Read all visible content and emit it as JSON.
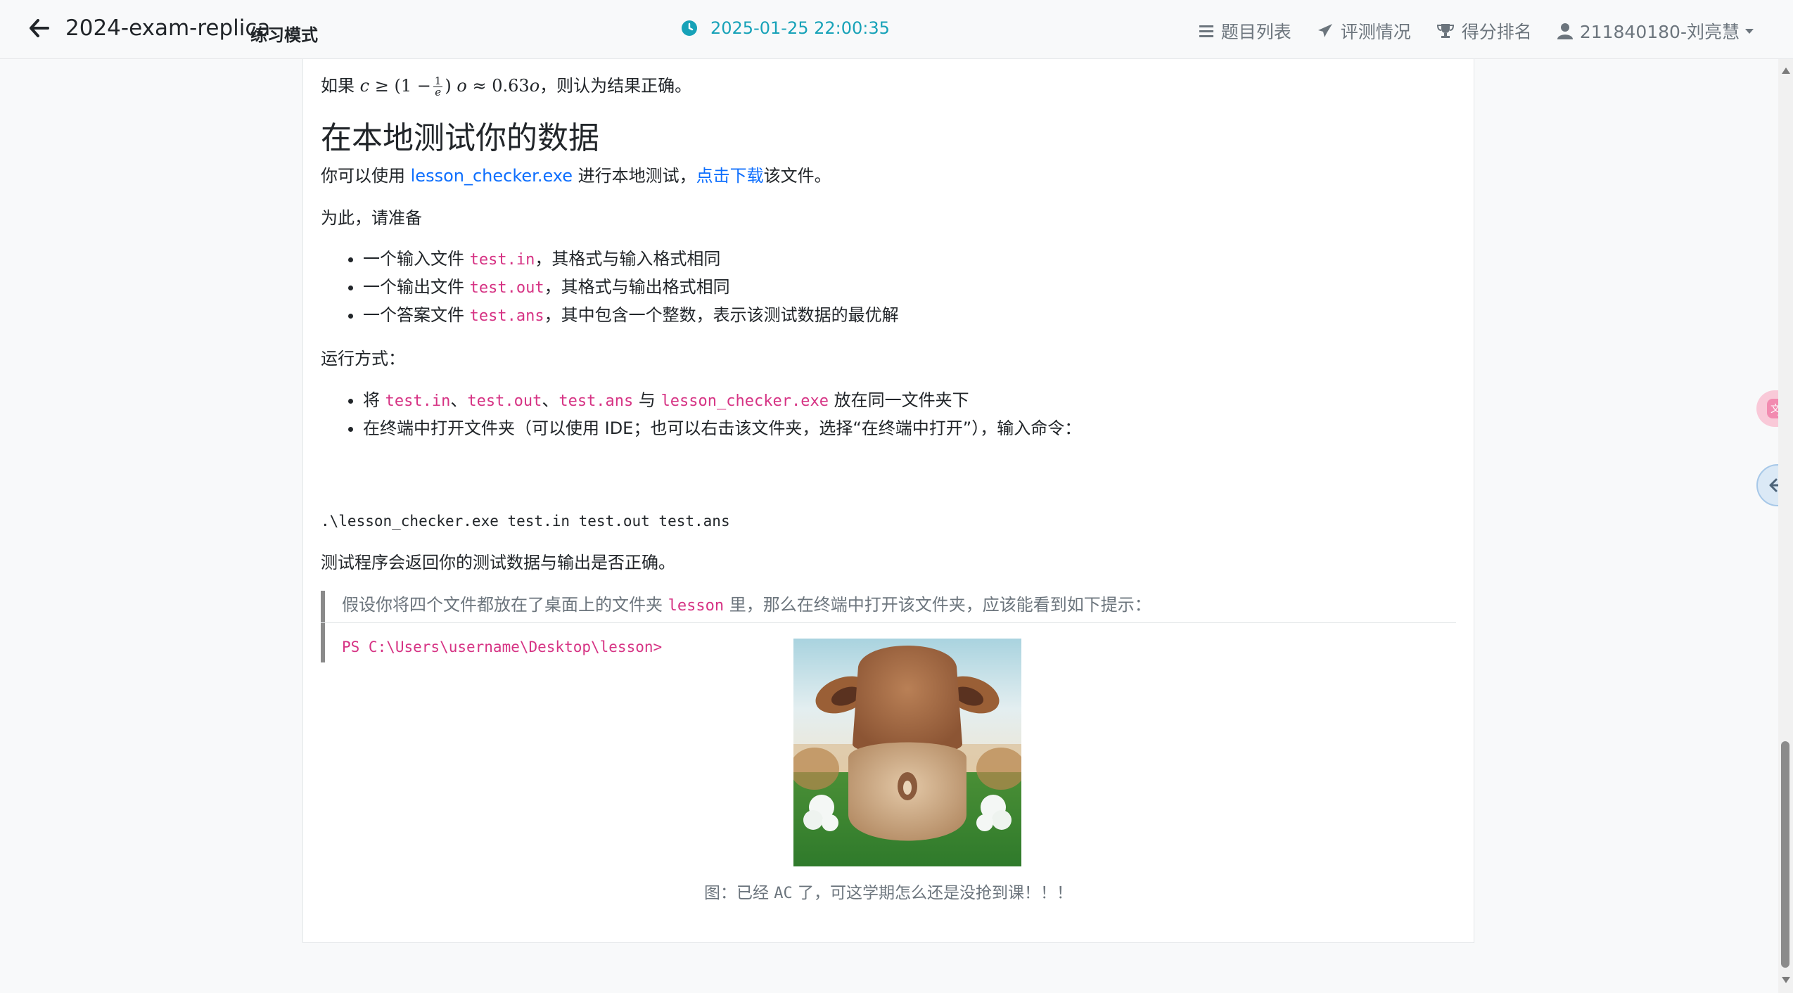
{
  "navbar": {
    "title": "2024-exam-replica",
    "mode": "练习模式",
    "time": "2025-01-25 22:00:35",
    "items": [
      {
        "label": "题目列表",
        "icon": "list-icon"
      },
      {
        "label": "评测情况",
        "icon": "paper-plane-icon"
      },
      {
        "label": "得分排名",
        "icon": "trophy-icon"
      },
      {
        "label": "211840180-刘亮慧",
        "icon": "user-icon"
      }
    ]
  },
  "content": {
    "condition": {
      "prefix": "如果",
      "suffix": "，则认为结果正确。",
      "formula": {
        "var_c": "c",
        "geq": "≥",
        "open": "(1 −",
        "frac_num": "1",
        "frac_den": "e",
        "close": ")",
        "var_o": "o",
        "approx": "≈ 0.63",
        "var_o2": "o"
      }
    },
    "heading": "在本地测试你的数据",
    "intro": {
      "prefix": "你可以使用 ",
      "link1": "lesson_checker.exe",
      "middle": " 进行本地测试，",
      "link2": "点击下载",
      "suffix": "该文件。"
    },
    "prepare": "为此，请准备",
    "prep_items": [
      {
        "before": "一个输入文件 ",
        "code": "test.in",
        "after": "，其格式与输入格式相同"
      },
      {
        "before": "一个输出文件 ",
        "code": "test.out",
        "after": "，其格式与输出格式相同"
      },
      {
        "before": "一个答案文件 ",
        "code": "test.ans",
        "after": "，其中包含一个整数，表示该测试数据的最优解"
      }
    ],
    "run_label": "运行方式：",
    "run_item1": {
      "t1": "将 ",
      "c1": "test.in",
      "t2": "、",
      "c2": "test.out",
      "t3": "、",
      "c3": "test.ans",
      "t4": " 与 ",
      "c4": "lesson_checker.exe",
      "t5": " 放在同一文件夹下"
    },
    "run_item2": "在终端中打开文件夹（可以使用 IDE；也可以右击该文件夹，选择“在终端中打开”），输入命令：",
    "command": ".\\lesson_checker.exe test.in test.out test.ans",
    "result_text": "测试程序会返回你的测试数据与输出是否正确。",
    "quote": {
      "before": "假设你将四个文件都放在了桌面上的文件夹 ",
      "code": "lesson",
      "after": " 里，那么在终端中打开该文件夹，应该能看到如下提示：",
      "prompt": "PS C:\\Users\\username\\Desktop\\lesson>"
    },
    "caption": {
      "before": "图：已经 ",
      "code": "AC",
      "after": " 了，可这学期怎么还是没抢到课！！！"
    }
  },
  "side_buttons": {
    "translate_icon": "translate-icon",
    "back_icon": "arrow-left-icon"
  },
  "colors": {
    "accent_time": "#17a2b8",
    "link": "#0d6efd",
    "code": "#d63384",
    "muted": "#6c757d"
  }
}
